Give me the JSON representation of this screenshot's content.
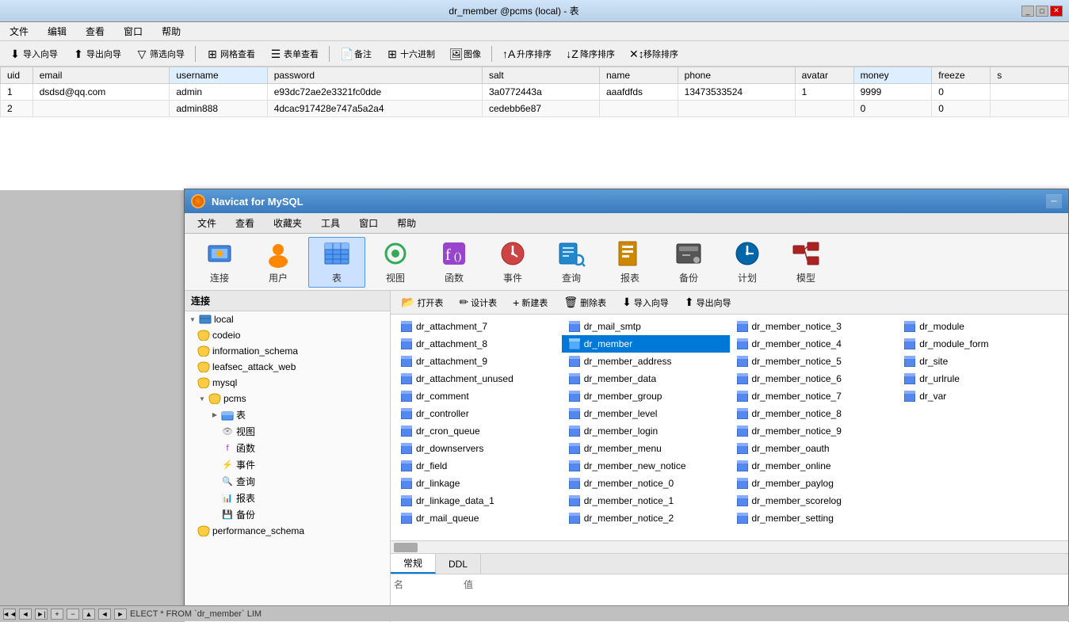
{
  "bg_window": {
    "title": "dr_member @pcms (local) - 表",
    "menubar": [
      "文件",
      "编辑",
      "查看",
      "窗口",
      "帮助"
    ],
    "toolbar": {
      "buttons": [
        "导入向导",
        "导出向导",
        "筛选向导",
        "网格查看",
        "表单查看",
        "备注",
        "十六进制",
        "图像",
        "升序排序",
        "降序排序",
        "移除排序"
      ]
    },
    "table": {
      "columns": [
        "uid",
        "email",
        "username",
        "password",
        "salt",
        "name",
        "phone",
        "avatar",
        "money",
        "freeze",
        "s"
      ],
      "rows": [
        {
          "uid": "1",
          "email": "dsdsd@qq.com",
          "username": "admin",
          "password": "e93dc72ae2e3321fc0dde",
          "salt": "3a0772443a",
          "name": "aaafdfds",
          "phone": "13473533524",
          "avatar": "1",
          "money": "9999",
          "freeze": "0",
          "s": ""
        },
        {
          "uid": "2",
          "email": "",
          "username": "admin888",
          "password": "4dcac917428e747a5a2a4",
          "salt": "cedebb6e87",
          "name": "",
          "phone": "",
          "avatar": "",
          "money": "0",
          "freeze": "0",
          "s": ""
        }
      ]
    }
  },
  "nav_window": {
    "title": "Navicat for MySQL",
    "menubar": [
      "文件",
      "查看",
      "收藏夹",
      "工具",
      "窗口",
      "帮助"
    ],
    "toolbar": {
      "items": [
        {
          "label": "连接",
          "icon": "connect-icon"
        },
        {
          "label": "用户",
          "icon": "user-icon"
        },
        {
          "label": "表",
          "icon": "table-icon",
          "active": true
        },
        {
          "label": "视图",
          "icon": "view-icon"
        },
        {
          "label": "函数",
          "icon": "function-icon"
        },
        {
          "label": "事件",
          "icon": "event-icon"
        },
        {
          "label": "查询",
          "icon": "query-icon"
        },
        {
          "label": "报表",
          "icon": "report-icon"
        },
        {
          "label": "备份",
          "icon": "backup-icon"
        },
        {
          "label": "计划",
          "icon": "schedule-icon"
        },
        {
          "label": "模型",
          "icon": "model-icon"
        }
      ]
    },
    "sidebar": {
      "header": "连接",
      "tree": [
        {
          "label": "local",
          "level": 0,
          "expanded": true,
          "type": "connection"
        },
        {
          "label": "codeio",
          "level": 1,
          "type": "database"
        },
        {
          "label": "information_schema",
          "level": 1,
          "type": "database"
        },
        {
          "label": "leafsec_attack_web",
          "level": 1,
          "type": "database"
        },
        {
          "label": "mysql",
          "level": 1,
          "type": "database"
        },
        {
          "label": "pcms",
          "level": 1,
          "expanded": true,
          "type": "database"
        },
        {
          "label": "表",
          "level": 2,
          "expanded": true,
          "type": "folder"
        },
        {
          "label": "视图",
          "level": 2,
          "type": "folder"
        },
        {
          "label": "函数",
          "level": 2,
          "type": "folder"
        },
        {
          "label": "事件",
          "level": 2,
          "type": "folder"
        },
        {
          "label": "查询",
          "level": 2,
          "type": "folder"
        },
        {
          "label": "报表",
          "level": 2,
          "type": "folder"
        },
        {
          "label": "备份",
          "level": 2,
          "type": "folder"
        },
        {
          "label": "performance_schema",
          "level": 1,
          "type": "database"
        }
      ]
    },
    "object_toolbar": {
      "buttons": [
        "打开表",
        "设计表",
        "新建表",
        "删除表",
        "导入向导",
        "导出向导"
      ]
    },
    "tables": [
      "dr_attachment_7",
      "dr_mail_smtp",
      "dr_member_notice_3",
      "dr_module",
      "dr_attachment_8",
      "dr_member",
      "dr_member_notice_4",
      "dr_module_form",
      "dr_attachment_9",
      "dr_member_address",
      "dr_member_notice_5",
      "dr_site",
      "dr_attachment_unused",
      "dr_member_data",
      "dr_member_notice_6",
      "dr_urlrule",
      "dr_comment",
      "dr_member_group",
      "dr_member_notice_7",
      "dr_var",
      "dr_controller",
      "dr_member_level",
      "dr_member_notice_8",
      "",
      "dr_cron_queue",
      "dr_member_login",
      "dr_member_notice_9",
      "",
      "dr_downservers",
      "dr_member_menu",
      "dr_member_oauth",
      "",
      "dr_field",
      "dr_member_new_notice",
      "dr_member_online",
      "",
      "dr_linkage",
      "dr_member_notice_0",
      "dr_member_paylog",
      "",
      "dr_linkage_data_1",
      "dr_member_notice_1",
      "dr_member_scorelog",
      "",
      "dr_mail_queue",
      "dr_member_notice_2",
      "dr_member_setting",
      ""
    ],
    "selected_table": "dr_member",
    "bottom_tabs": [
      "常规",
      "DDL"
    ],
    "active_bottom_tab": "常规",
    "bottom_fields": {
      "label_name": "名",
      "label_value": "值"
    }
  },
  "statusbar": {
    "buttons": [
      "◄",
      "◄",
      "►|",
      "+",
      "-",
      "▲",
      "◄",
      "►"
    ],
    "sql_text": "ELECT * FROM `dr_member` LIM"
  }
}
